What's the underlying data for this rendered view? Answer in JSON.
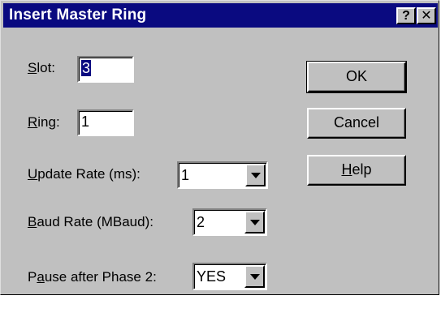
{
  "dialog": {
    "title": "Insert Master Ring",
    "help_glyph": "?",
    "close_glyph": "✕"
  },
  "fields": {
    "slot": {
      "label_mnemonic": "S",
      "label_rest": "lot:",
      "value": "3"
    },
    "ring": {
      "label_mnemonic": "R",
      "label_rest": "ing:",
      "value": "1"
    },
    "update_rate": {
      "label_mnemonic": "U",
      "label_rest": "pdate Rate (ms):",
      "value": "1"
    },
    "baud_rate": {
      "label_mnemonic": "B",
      "label_rest": "aud Rate (MBaud):",
      "value": "2"
    },
    "pause": {
      "label_pre": "P",
      "label_mnemonic": "a",
      "label_rest": "use after Phase 2:",
      "value": "YES"
    }
  },
  "buttons": {
    "ok": "OK",
    "cancel": "Cancel",
    "help_mnemonic": "H",
    "help_rest": "elp"
  },
  "colors": {
    "titlebar": "#0a0a80",
    "face": "#c0c0c0"
  }
}
